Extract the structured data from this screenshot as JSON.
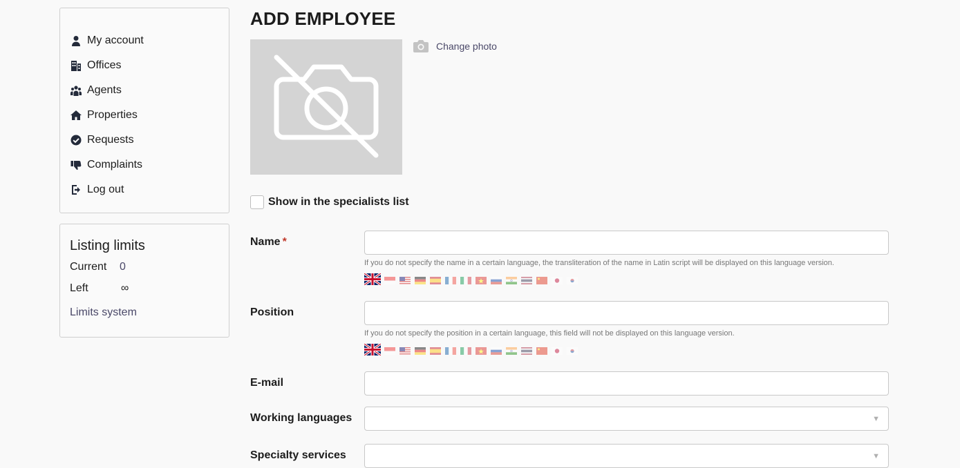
{
  "sidebar": {
    "menu": [
      {
        "label": "My account",
        "icon": "user-icon"
      },
      {
        "label": "Offices",
        "icon": "building-icon"
      },
      {
        "label": "Agents",
        "icon": "users-icon"
      },
      {
        "label": "Properties",
        "icon": "home-icon"
      },
      {
        "label": "Requests",
        "icon": "check-circle-icon"
      },
      {
        "label": "Complaints",
        "icon": "thumbs-down-icon"
      },
      {
        "label": "Log out",
        "icon": "logout-icon"
      }
    ],
    "limits": {
      "title": "Listing limits",
      "current_label": "Current",
      "current_value": "0",
      "left_label": "Left",
      "left_value": "∞",
      "link": "Limits system"
    }
  },
  "main": {
    "title": "ADD EMPLOYEE",
    "change_photo": "Change photo",
    "show_specialists": "Show in the specialists list",
    "name": {
      "label": "Name",
      "required_mark": "*",
      "value": "",
      "hint": "If you do not specify the name in a certain language, the transliteration of the name in Latin script will be displayed on this language version."
    },
    "position": {
      "label": "Position",
      "value": "",
      "hint": "If you do not specify the position in a certain language, this field will not be displayed on this language version."
    },
    "email": {
      "label": "E-mail",
      "value": ""
    },
    "working_languages": {
      "label": "Working languages",
      "value": ""
    },
    "specialty_services": {
      "label": "Specialty services",
      "value": ""
    }
  },
  "flags": [
    "uk",
    "id",
    "my",
    "de",
    "es",
    "fr",
    "it",
    "vn",
    "ru",
    "in",
    "th",
    "cn",
    "jp",
    "kr"
  ],
  "colors": {
    "link": "#4a4868",
    "required": "#c0392b",
    "icon": "#232a3a",
    "photo_bg": "#d4d4d4"
  }
}
